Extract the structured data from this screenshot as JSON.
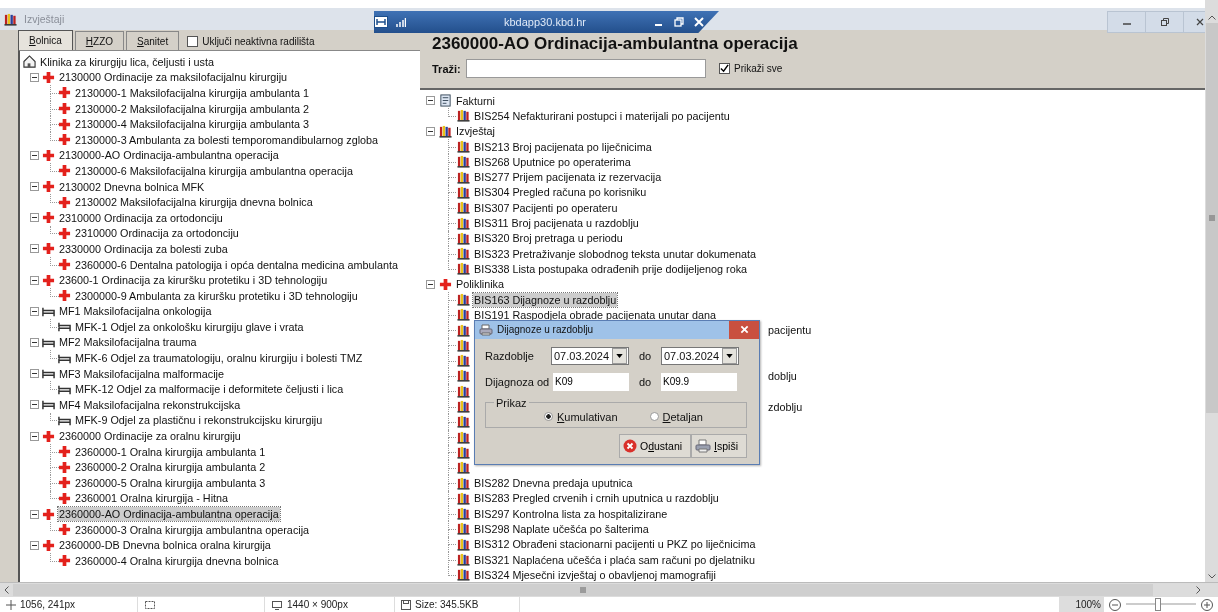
{
  "title_bar": {
    "app_title": "Izvještaji",
    "remote_host": "kbdapp30.kbd.hr"
  },
  "left_panel": {
    "tabs": [
      {
        "label": "Bolnica",
        "selected": true
      },
      {
        "label": "HZZO",
        "selected": false
      },
      {
        "label": "Sanitet",
        "selected": false
      }
    ],
    "include_inactive": {
      "label": "Uključi neaktivna radilišta",
      "checked": false
    },
    "tree": [
      {
        "kind": "home",
        "label": "Klinika za kirurgiju lica, čeljusti i usta",
        "selected": false,
        "children": [
          {
            "kind": "cross",
            "label": "2130000 Ordinacije za maksilofacijalnu kirurgiju",
            "selected": false,
            "expanded": true,
            "children": [
              {
                "kind": "cross",
                "label": "2130000-1 Maksilofacijalna kirurgija ambulanta 1",
                "selected": false
              },
              {
                "kind": "cross",
                "label": "2130000-2 Maksilofacijalna kirurgija ambulanta 2",
                "selected": false
              },
              {
                "kind": "cross",
                "label": "2130000-4 Maksilofacijalna kirurgija ambulanta 3",
                "selected": false
              },
              {
                "kind": "cross",
                "label": "2130000-3 Ambulanta za bolesti temporomandibularnog zgloba",
                "selected": false
              }
            ]
          },
          {
            "kind": "cross",
            "label": "2130000-AO Ordinacija-ambulantna operacija",
            "selected": false,
            "expanded": true,
            "children": [
              {
                "kind": "cross",
                "label": "2130000-6 Maksilofacijalna kirurgija ambulantna operacija",
                "selected": false
              }
            ]
          },
          {
            "kind": "cross",
            "label": "2130002 Dnevna bolnica MFK",
            "selected": false,
            "expanded": true,
            "children": [
              {
                "kind": "cross",
                "label": "2130002 Maksilofacijalna kirurgija dnevna bolnica",
                "selected": false
              }
            ]
          },
          {
            "kind": "cross",
            "label": "2310000 Ordinacija za ortodonciju",
            "selected": false,
            "expanded": true,
            "children": [
              {
                "kind": "cross",
                "label": "2310000 Ordinacija za ortodonciju",
                "selected": false
              }
            ]
          },
          {
            "kind": "cross",
            "label": "2330000 Ordinacija za bolesti zuba",
            "selected": false,
            "expanded": true,
            "children": [
              {
                "kind": "cross",
                "label": "2360000-6 Dentalna patologija i opća dentalna medicina ambulanta",
                "selected": false
              }
            ]
          },
          {
            "kind": "cross",
            "label": "23600-1 Ordinacija za kiruršku protetiku i 3D tehnologiju",
            "selected": false,
            "expanded": true,
            "children": [
              {
                "kind": "cross",
                "label": "2300000-9 Ambulanta za kiruršku protetiku i 3D tehnologiju",
                "selected": false
              }
            ]
          },
          {
            "kind": "bed",
            "label": "MF1 Maksilofacijalna onkologija",
            "selected": false,
            "expanded": true,
            "children": [
              {
                "kind": "bed",
                "label": "MFK-1 Odjel za onkološku kirurgiju glave i vrata",
                "selected": false
              }
            ]
          },
          {
            "kind": "bed",
            "label": "MF2 Maksilofacijalna trauma",
            "selected": false,
            "expanded": true,
            "children": [
              {
                "kind": "bed",
                "label": "MFK-6 Odjel za traumatologiju, oralnu kirurgiju i bolesti TMZ",
                "selected": false
              }
            ]
          },
          {
            "kind": "bed",
            "label": "MF3 Maksilofacijalna malformacije",
            "selected": false,
            "expanded": true,
            "children": [
              {
                "kind": "bed",
                "label": "MFK-12 Odjel za malformacije i deformitete čeljusti i lica",
                "selected": false
              }
            ]
          },
          {
            "kind": "bed",
            "label": "MF4 Maksilofacijalna rekonstrukcijska",
            "selected": false,
            "expanded": true,
            "children": [
              {
                "kind": "bed",
                "label": "MFK-9 Odjel za plastičnu i rekonstrukcijsku kirurgiju",
                "selected": false
              }
            ]
          },
          {
            "kind": "cross",
            "label": "2360000 Ordinacije za oralnu kirurgiju",
            "selected": false,
            "expanded": true,
            "children": [
              {
                "kind": "cross",
                "label": "2360000-1 Oralna kirurgija ambulanta 1",
                "selected": false
              },
              {
                "kind": "cross",
                "label": "2360000-2 Oralna kirurgija ambulanta 2",
                "selected": false
              },
              {
                "kind": "cross",
                "label": "2360000-5 Oralna kirurgija ambulanta 3",
                "selected": false
              },
              {
                "kind": "cross",
                "label": "2360001 Oralna kirurgija - Hitna",
                "selected": false
              }
            ]
          },
          {
            "kind": "cross",
            "label": "2360000-AO Ordinacija-ambulantna operacija",
            "selected": true,
            "expanded": true,
            "children": [
              {
                "kind": "cross",
                "label": "2360000-3 Oralna kirurgija ambulantna operacija",
                "selected": false
              }
            ]
          },
          {
            "kind": "cross",
            "label": "2360000-DB Dnevna bolnica oralna kirurgija",
            "selected": false,
            "expanded": true,
            "children": [
              {
                "kind": "cross",
                "label": "2360000-4 Oralna kirurgija dnevna bolnica",
                "selected": false
              }
            ]
          }
        ]
      }
    ]
  },
  "right_panel": {
    "heading": "2360000-AO Ordinacija-ambulantna operacija",
    "search": {
      "label": "Traži:"
    },
    "show_all": {
      "label": "Prikaži sve",
      "checked": true
    },
    "tree": [
      {
        "kind": "document",
        "label": "Fakturni",
        "selected": false,
        "expanded": true,
        "children": [
          {
            "kind": "books",
            "label": "BIS254 Nefakturirani postupci i materijali po pacijentu",
            "selected": false
          }
        ]
      },
      {
        "kind": "books",
        "label": "Izvještaj",
        "selected": false,
        "expanded": true,
        "children": [
          {
            "kind": "books",
            "label": "BIS213 Broj pacijenata po liječnicima",
            "selected": false
          },
          {
            "kind": "books",
            "label": "BIS268 Uputnice po operaterima",
            "selected": false
          },
          {
            "kind": "books",
            "label": "BIS277 Prijem pacijenata iz rezervacija",
            "selected": false
          },
          {
            "kind": "books",
            "label": "BIS304 Pregled računa po korisniku",
            "selected": false
          },
          {
            "kind": "books",
            "label": "BIS307 Pacijenti po operateru",
            "selected": false
          },
          {
            "kind": "books",
            "label": "BIS311 Broj pacijenata u razdoblju",
            "selected": false
          },
          {
            "kind": "books",
            "label": "BIS320 Broj pretraga u periodu",
            "selected": false
          },
          {
            "kind": "books",
            "label": "BIS323 Pretraživanje slobodnog teksta unutar dokumenata",
            "selected": false
          },
          {
            "kind": "books",
            "label": "BIS338 Lista postupaka odrađenih prije dodijeljenog roka",
            "selected": false
          }
        ]
      },
      {
        "kind": "cross",
        "label": "Poliklinika",
        "selected": false,
        "expanded": true,
        "children": [
          {
            "kind": "books",
            "label": "BIS163 Dijagnoze u razdoblju",
            "selected": true
          },
          {
            "kind": "books",
            "label": "BIS191 Raspodjela obrade pacijenata unutar dana",
            "selected": false
          },
          {
            "kind": "books",
            "covered": true,
            "label": "pacijentu"
          },
          {
            "kind": "books",
            "covered": true
          },
          {
            "kind": "books",
            "covered": true
          },
          {
            "kind": "books",
            "covered": true,
            "label": "doblju"
          },
          {
            "kind": "books",
            "covered": true
          },
          {
            "kind": "books",
            "covered": true,
            "label": "zdoblju"
          },
          {
            "kind": "books",
            "covered": true
          },
          {
            "kind": "books",
            "covered": true
          },
          {
            "kind": "books",
            "covered": true
          },
          {
            "kind": "books",
            "covered": true
          },
          {
            "kind": "books",
            "label": "BIS282 Dnevna predaja uputnica",
            "selected": false
          },
          {
            "kind": "books",
            "label": "BIS283 Pregled crvenih i crnih uputnica u razdoblju",
            "selected": false
          },
          {
            "kind": "books",
            "label": "BIS297 Kontrolna lista za hospitalizirane",
            "selected": false
          },
          {
            "kind": "books",
            "label": "BIS298 Naplate učešća po šalterima",
            "selected": false
          },
          {
            "kind": "books",
            "label": "BIS312 Obrađeni stacionarni pacijenti u PKZ po liječnicima",
            "selected": false
          },
          {
            "kind": "books",
            "label": "BIS321 Naplaćena učešća i plaća sam računi po djelatniku",
            "selected": false
          },
          {
            "kind": "books",
            "label": "BIS324 Mjesečni izvještaj o obavljenoj mamografiji",
            "selected": false
          }
        ]
      }
    ]
  },
  "dialog": {
    "title": "Dijagnoze u razdoblju",
    "period_label": "Razdoblje",
    "date_from": "07.03.2024",
    "period_to_label": "do",
    "date_to": "07.03.2024",
    "diagnosis_label": "Dijagnoza od",
    "diagnosis_from": "K09",
    "diagnosis_to_label": "do",
    "diagnosis_to": "K09.9",
    "group_label": "Prikaz",
    "options": [
      {
        "label": "Kumulativan",
        "selected": true
      },
      {
        "label": "Detaljan",
        "selected": false
      }
    ],
    "buttons": [
      {
        "kind": "cancel",
        "label": "Odustani"
      },
      {
        "kind": "print",
        "label": "Ispiši"
      }
    ]
  },
  "status_bar": {
    "cursor": "1056, 241px",
    "dimensions": "1440 × 900px",
    "size": "Size: 345.5KB",
    "zoom": "100%",
    "zoom_slider": {
      "level": 0.45
    }
  }
}
